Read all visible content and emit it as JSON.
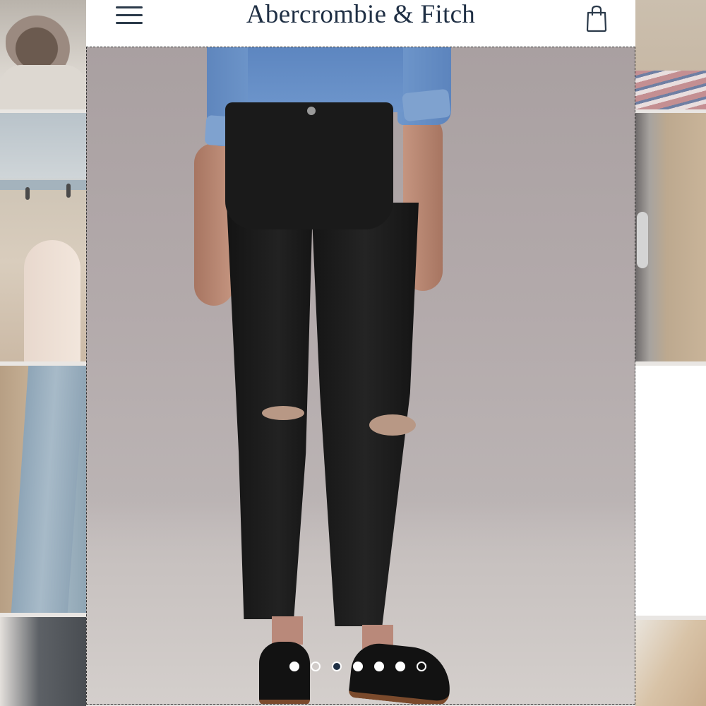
{
  "header": {
    "brand": "Abercrombie & Fitch",
    "menu_icon": "hamburger-menu-icon",
    "bag_icon": "shopping-bag-icon",
    "brand_color": "#1f2f44"
  },
  "product_image": {
    "subject": "black ripped skinny jeans",
    "image_index_of_total": {
      "current": 3,
      "total": 7
    }
  },
  "carousel": {
    "dots": [
      {
        "state": "filled"
      },
      {
        "state": "outline"
      },
      {
        "state": "active"
      },
      {
        "state": "filled"
      },
      {
        "state": "filled"
      },
      {
        "state": "filled"
      },
      {
        "state": "outline"
      }
    ]
  },
  "colors": {
    "background": "#e9e6e3",
    "header_bg": "#ffffff",
    "dot_active": "#1f2f44"
  }
}
